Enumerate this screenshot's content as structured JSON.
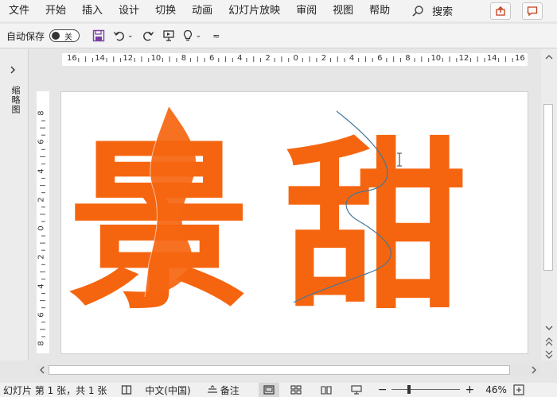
{
  "menu": {
    "items": [
      "文件",
      "开始",
      "插入",
      "设计",
      "切换",
      "动画",
      "幻灯片放映",
      "审阅",
      "视图",
      "帮助"
    ],
    "search_label": "搜索"
  },
  "qat": {
    "autosave_label": "自动保存",
    "autosave_state": "关"
  },
  "left_panel": {
    "label": "缩略图"
  },
  "ruler": {
    "horizontal": [
      "16",
      "14",
      "12",
      "10",
      "8",
      "6",
      "4",
      "2",
      "0",
      "2",
      "4",
      "6",
      "8",
      "10",
      "12",
      "14",
      "16"
    ],
    "vertical": [
      "8",
      "6",
      "4",
      "2",
      "0",
      "2",
      "4",
      "6",
      "8"
    ]
  },
  "slide": {
    "char1": "景",
    "char2": "甜",
    "text_color": "#f5650f",
    "curve_color": "#44779b"
  },
  "status": {
    "slide_info": "幻灯片 第 1 张，共 1 张",
    "language": "中文(中国)",
    "notes_label": "备注",
    "zoom_minus": "−",
    "zoom_plus": "+",
    "zoom_level": "46%"
  },
  "colors": {
    "accent": "#c43e1c",
    "save_icon": "#7a3fa3"
  }
}
